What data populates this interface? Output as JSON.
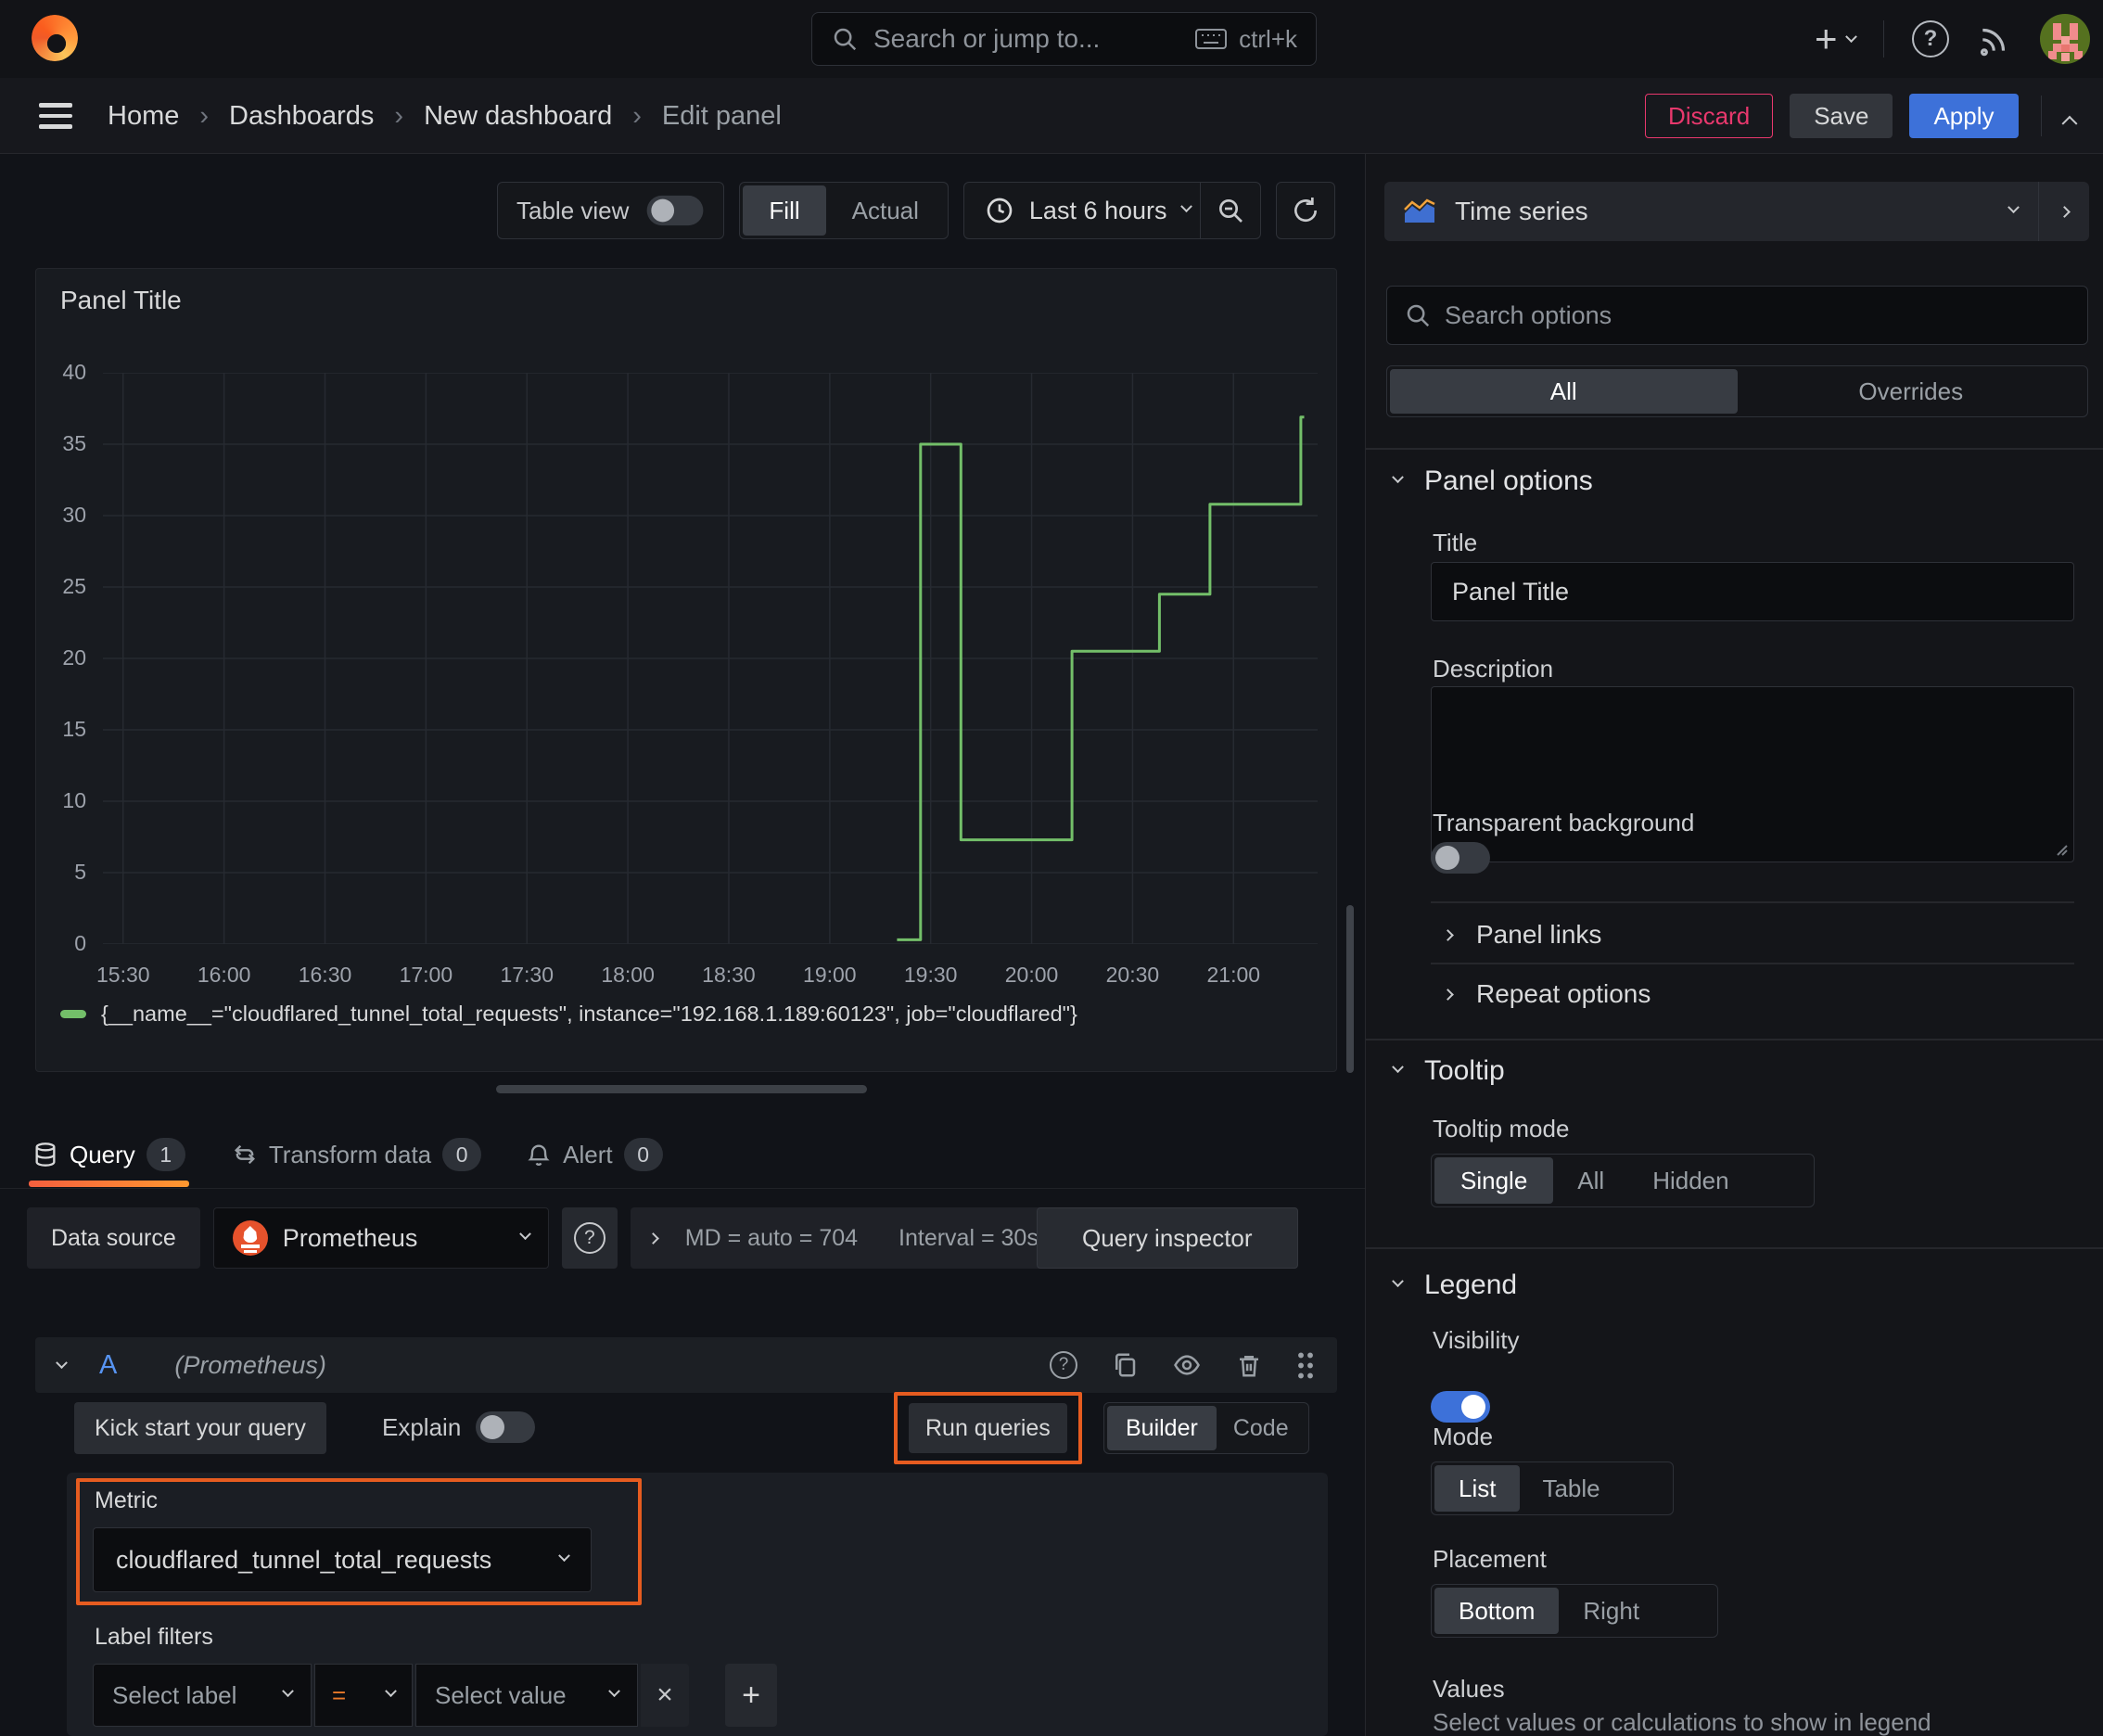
{
  "colors": {
    "accent_blue": "#3D71D9",
    "annotation_orange": "#E65C20",
    "series_green": "#73BF69",
    "discard_red": "#E8386D"
  },
  "topbar": {
    "search_placeholder": "Search or jump to...",
    "search_shortcut": "ctrl+k"
  },
  "breadcrumb": {
    "items": [
      "Home",
      "Dashboards",
      "New dashboard",
      "Edit panel"
    ],
    "separator": "›"
  },
  "header_actions": {
    "discard": "Discard",
    "save": "Save",
    "apply": "Apply"
  },
  "panel_toolbar": {
    "table_view_label": "Table view",
    "fit_fill": "Fill",
    "fit_actual": "Actual",
    "time_range": "Last 6 hours"
  },
  "viz_picker": {
    "label": "Time series"
  },
  "panel": {
    "title": "Panel Title"
  },
  "chart_data": {
    "type": "line",
    "step": true,
    "title": "Panel Title",
    "x_domain": [
      "15:24",
      "21:25"
    ],
    "x_ticks": [
      "15:30",
      "16:00",
      "16:30",
      "17:00",
      "17:30",
      "18:00",
      "18:30",
      "19:00",
      "19:30",
      "20:00",
      "20:30",
      "21:00"
    ],
    "ylim": [
      0,
      40
    ],
    "y_ticks": [
      0,
      5,
      10,
      15,
      20,
      25,
      30,
      35,
      40
    ],
    "grid": true,
    "legend_position": "bottom",
    "series": [
      {
        "name": "{__name__=\"cloudflared_tunnel_total_requests\", instance=\"192.168.1.189:60123\", job=\"cloudflared\"}",
        "color": "#73BF69",
        "points": [
          [
            "19:20",
            0.3
          ],
          [
            "19:27",
            0.3
          ],
          [
            "19:27",
            35
          ],
          [
            "19:39",
            35
          ],
          [
            "19:39",
            7.3
          ],
          [
            "20:12",
            7.3
          ],
          [
            "20:12",
            20.5
          ],
          [
            "20:38",
            20.5
          ],
          [
            "20:38",
            24.5
          ],
          [
            "20:53",
            24.5
          ],
          [
            "20:53",
            30.8
          ],
          [
            "21:20",
            30.8
          ],
          [
            "21:20",
            36.9
          ],
          [
            "21:21",
            36.9
          ]
        ]
      }
    ]
  },
  "query_section": {
    "tabs": [
      {
        "label": "Query",
        "count": "1"
      },
      {
        "label": "Transform data",
        "count": "0"
      },
      {
        "label": "Alert",
        "count": "0"
      }
    ],
    "datasource": {
      "label": "Data source",
      "name": "Prometheus",
      "max_data_points": "MD = auto = 704",
      "interval": "Interval = 30s",
      "inspector_button": "Query inspector"
    },
    "query_row": {
      "ref_id": "A",
      "hint": "(Prometheus)"
    },
    "toolbar": {
      "kick_start": "Kick start your query",
      "explain_label": "Explain",
      "run_queries": "Run queries",
      "builder": "Builder",
      "code": "Code"
    },
    "builder": {
      "metric_label": "Metric",
      "metric_value": "cloudflared_tunnel_total_requests",
      "label_filters_label": "Label filters",
      "select_label_placeholder": "Select label",
      "operator": "=",
      "select_value_placeholder": "Select value"
    }
  },
  "options_pane": {
    "search_placeholder": "Search options",
    "filter_tabs": {
      "all": "All",
      "overrides": "Overrides"
    },
    "panel_options": {
      "heading": "Panel options",
      "title_label": "Title",
      "title_value": "Panel Title",
      "description_label": "Description",
      "description_value": "",
      "transparent_label": "Transparent background"
    },
    "collapsed_sections": {
      "panel_links": "Panel links",
      "repeat_options": "Repeat options"
    },
    "tooltip": {
      "heading": "Tooltip",
      "mode_label": "Tooltip mode",
      "mode_options": [
        "Single",
        "All",
        "Hidden"
      ],
      "mode_selected": "Single"
    },
    "legend": {
      "heading": "Legend",
      "visibility_label": "Visibility",
      "visibility_on": true,
      "mode_label": "Mode",
      "mode_options": [
        "List",
        "Table"
      ],
      "mode_selected": "List",
      "placement_label": "Placement",
      "placement_options": [
        "Bottom",
        "Right"
      ],
      "placement_selected": "Bottom",
      "values_label": "Values",
      "values_hint": "Select values or calculations to show in legend"
    }
  }
}
